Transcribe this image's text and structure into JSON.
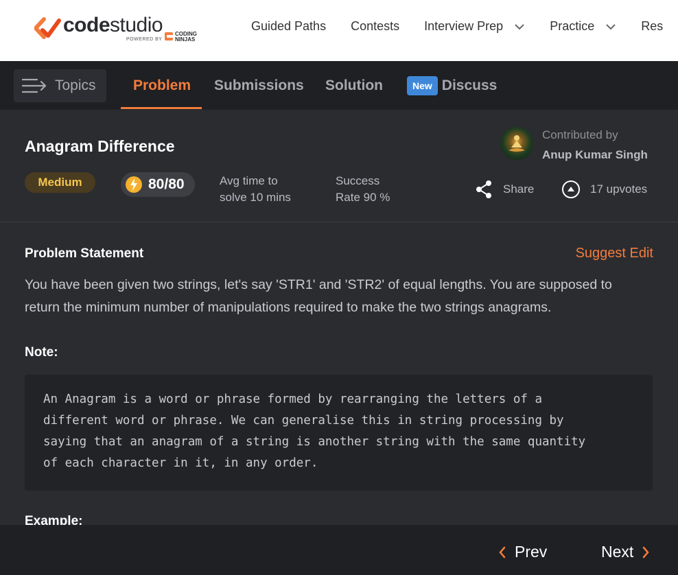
{
  "logo": {
    "name_part1": "code",
    "name_part2": "studio",
    "powered_by": "POWERED BY",
    "partner_line1": "CODING",
    "partner_line2": "NINJAS"
  },
  "nav": {
    "items": [
      {
        "label": "Guided Paths",
        "dropdown": false
      },
      {
        "label": "Contests",
        "dropdown": false
      },
      {
        "label": "Interview Prep",
        "dropdown": true
      },
      {
        "label": "Practice",
        "dropdown": true
      },
      {
        "label": "Res",
        "dropdown": false
      }
    ]
  },
  "tabs": {
    "topics_label": "Topics",
    "items": [
      {
        "label": "Problem",
        "active": true
      },
      {
        "label": "Submissions",
        "active": false
      },
      {
        "label": "Solution",
        "active": false
      },
      {
        "label": "Discuss",
        "active": false,
        "badge": "New"
      }
    ]
  },
  "problem": {
    "title": "Anagram Difference",
    "difficulty": "Medium",
    "score": "80/80",
    "avg_time_line1": "Avg time to",
    "avg_time_line2": "solve 10 mins",
    "success_line1": "Success",
    "success_line2": "Rate 90 %",
    "contributed_label": "Contributed by",
    "contributor": "Anup Kumar Singh",
    "share_label": "Share",
    "upvotes_label": "17 upvotes"
  },
  "statement": {
    "heading": "Problem Statement",
    "suggest_edit": "Suggest Edit",
    "paragraph": "You have been given two strings, let's say 'STR1' and 'STR2' of equal lengths. You are supposed to return the minimum number of manipulations required to make the two strings anagrams.",
    "note_heading": "Note:",
    "note_code": "An Anagram is a word or phrase formed by rearranging the letters of a\ndifferent word or phrase. We can generalise this in string processing by\nsaying that an anagram of a string is another string with the same quantity\nof each character in it, in any order.",
    "example_heading": "Example:"
  },
  "footer": {
    "prev_label": "Prev",
    "next_label": "Next"
  },
  "colors": {
    "accent": "#f47c3c",
    "badge_blue": "#3f88d9",
    "difficulty_text": "#f5c64e",
    "page_bg": "#2b2c30",
    "bar_bg": "#1f2023"
  }
}
